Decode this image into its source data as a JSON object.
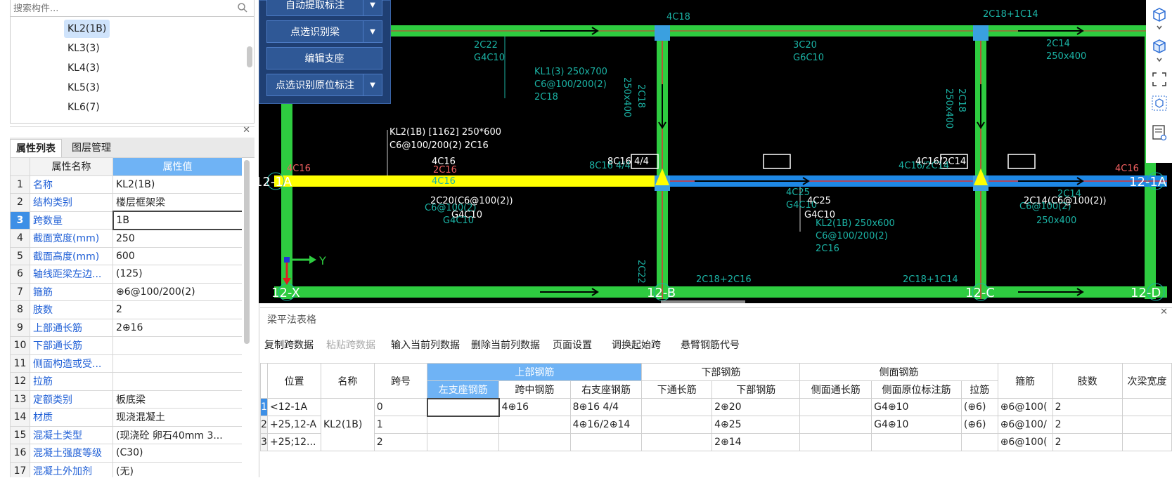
{
  "search": {
    "placeholder": "搜索构件..."
  },
  "tree": {
    "items": [
      "KL2(1B)",
      "KL3(3)",
      "KL4(3)",
      "KL5(3)",
      "KL6(7)"
    ],
    "selected": "KL2(1B)"
  },
  "panel_tabs": [
    "属性列表",
    "图层管理"
  ],
  "props": {
    "col_name": "属性名称",
    "col_value": "属性值",
    "rows": [
      {
        "n": "1",
        "name": "名称",
        "value": "KL2(1B)"
      },
      {
        "n": "2",
        "name": "结构类别",
        "value": "楼层框架梁"
      },
      {
        "n": "3",
        "name": "跨数量",
        "value": "1B"
      },
      {
        "n": "4",
        "name": "截面宽度(mm)",
        "value": "250"
      },
      {
        "n": "5",
        "name": "截面高度(mm)",
        "value": "600"
      },
      {
        "n": "6",
        "name": "轴线距梁左边...",
        "value": "(125)"
      },
      {
        "n": "7",
        "name": "箍筋",
        "value": "⊕6@100/200(2)"
      },
      {
        "n": "8",
        "name": "肢数",
        "value": "2"
      },
      {
        "n": "9",
        "name": "上部通长筋",
        "value": "2⊕16"
      },
      {
        "n": "10",
        "name": "下部通长筋",
        "value": ""
      },
      {
        "n": "11",
        "name": "侧面构造或受...",
        "value": ""
      },
      {
        "n": "12",
        "name": "拉筋",
        "value": ""
      },
      {
        "n": "13",
        "name": "定额类别",
        "value": "板底梁"
      },
      {
        "n": "14",
        "name": "材质",
        "value": "现浇混凝土"
      },
      {
        "n": "15",
        "name": "混凝土类型",
        "value": "(现浇砼 卵石40mm 3..."
      },
      {
        "n": "16",
        "name": "混凝土强度等级",
        "value": "(C30)"
      },
      {
        "n": "17",
        "name": "混凝土外加剂",
        "value": "(无)"
      }
    ]
  },
  "toolmenu": {
    "buttons": [
      {
        "label": "自动提取标注",
        "dropdown": true
      },
      {
        "label": "点选识别梁",
        "dropdown": true
      },
      {
        "label": "编辑支座",
        "dropdown": false
      },
      {
        "label": "点选识别原位标注",
        "dropdown": true
      }
    ]
  },
  "cad": {
    "axes": {
      "A": "12-1A",
      "X": "12-X",
      "B": "12-B",
      "C": "12-C",
      "D": "12-D",
      "Y": "Y"
    },
    "labels": {
      "t1": "4C18",
      "t2": "2C18+1C14",
      "t3": "2C22",
      "t4": "G4C10",
      "t5": "KL1(3) 250x700",
      "t6": "C6@100/200(2)",
      "t7": "2C18",
      "t8": "250x400",
      "t9": "2C18",
      "t10": "3C20",
      "t11": "G6C10",
      "t12": "2C14",
      "t13": "250x400",
      "t14": "250x400",
      "t15": "2C18",
      "t16": "KL2(1B) [1162] 250*600",
      "t17": "C6@100/200(2) 2C16",
      "t18": "4C16",
      "t19": "4C16",
      "t20": "2C16",
      "t21": "8C16 4/4",
      "t22": "8C16 4/4",
      "t23": "4C16/2C14",
      "t24": "4C16/2C14",
      "t25": "4C16",
      "t26": "2C20(C6@100(2))",
      "t27": "C6@100(2)",
      "t28": "G4C10",
      "t29": "G4C10",
      "t30": "4C25",
      "t31": "4C25",
      "t32": "G4C10",
      "t33": "G4C10",
      "t34": "KL2(1B) 250x600",
      "t35": "C6@100/200(2)",
      "t36": "2C16",
      "t37": "2C14(C6@100(2))",
      "t38": "C6@100(2)",
      "t39": "250x400",
      "t40": "2C14",
      "t41": "2C22",
      "t42": "2C18+2C16",
      "t43": "2C18+1C14"
    }
  },
  "beam_table": {
    "title": "梁平法表格",
    "tools": [
      {
        "label": "复制跨数据",
        "disabled": false
      },
      {
        "label": "粘贴跨数据",
        "disabled": true
      },
      {
        "label": "输入当前列数据",
        "disabled": false
      },
      {
        "label": "删除当前列数据",
        "disabled": false
      },
      {
        "label": "页面设置",
        "disabled": false
      },
      {
        "label": "调换起始跨",
        "disabled": false
      },
      {
        "label": "悬臂钢筋代号",
        "disabled": false
      }
    ],
    "headers": {
      "pos": "位置",
      "name": "名称",
      "span": "跨号",
      "top_group": "上部钢筋",
      "left_support": "左支座钢筋",
      "mid": "跨中钢筋",
      "right_support": "右支座钢筋",
      "bottom_group": "下部钢筋",
      "bottom_through": "下通长筋",
      "bottom": "下部钢筋",
      "side_group": "侧面钢筋",
      "side_through": "侧面通长筋",
      "side_orig": "侧面原位标注筋",
      "tie": "拉筋",
      "stirrup": "箍筋",
      "legs": "肢数",
      "secondary": "次梁宽度"
    },
    "rows": [
      {
        "n": "1",
        "pos": "<12-1A",
        "name": "KL2(1B)",
        "span": "0",
        "left": "",
        "mid": "4⊕16",
        "right": "8⊕16 4/4",
        "bt": "",
        "bottom": "2⊕20",
        "st": "",
        "so": "G4⊕10",
        "tie": "(⊕6)",
        "stirrup": "⊕6@100(",
        "legs": "2",
        "sec": ""
      },
      {
        "n": "2",
        "pos": "+25,12-A",
        "name": "",
        "span": "1",
        "left": "",
        "mid": "",
        "right": "4⊕16/2⊕14",
        "bt": "",
        "bottom": "4⊕25",
        "st": "",
        "so": "G4⊕10",
        "tie": "(⊕6)",
        "stirrup": "⊕6@100/",
        "legs": "2",
        "sec": ""
      },
      {
        "n": "3",
        "pos": "+25;12...",
        "name": "",
        "span": "2",
        "left": "",
        "mid": "",
        "right": "",
        "bt": "",
        "bottom": "2⊕14",
        "st": "",
        "so": "",
        "tie": "",
        "stirrup": "⊕6@100(",
        "legs": "2",
        "sec": ""
      }
    ]
  },
  "colors": {
    "beam_green": "#2ecc40",
    "beam_yellow": "#ffff00",
    "beam_blue": "#1e88e5",
    "annot_cyan": "#1bb3a5",
    "accent": "#3d8fe6"
  }
}
